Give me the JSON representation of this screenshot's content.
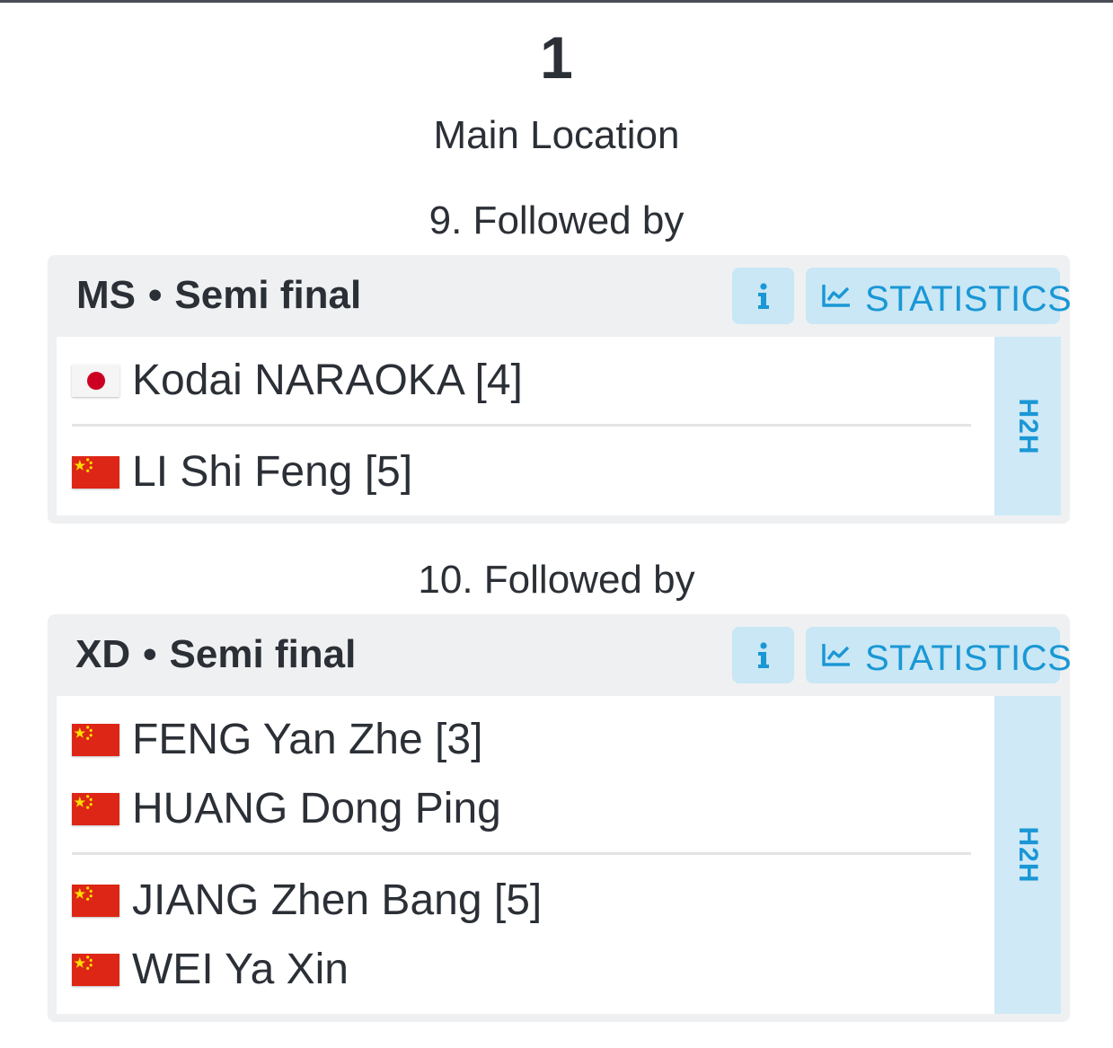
{
  "court": {
    "number": "1",
    "location": "Main Location"
  },
  "matches": [
    {
      "followed_label": "9. Followed by",
      "event": "MS",
      "separator": "•",
      "round": "Semi final",
      "info_icon": "info-icon",
      "statistics_label": "STATISTICS",
      "statistics_icon": "line-chart-icon",
      "h2h_label": "H2H",
      "teams": [
        {
          "players": [
            {
              "name": "Kodai NARAOKA [4]",
              "flag": "japan-flag-icon"
            }
          ]
        },
        {
          "players": [
            {
              "name": "LI Shi Feng [5]",
              "flag": "china-flag-icon"
            }
          ]
        }
      ]
    },
    {
      "followed_label": "10. Followed by",
      "event": "XD",
      "separator": "•",
      "round": "Semi final",
      "info_icon": "info-icon",
      "statistics_label": "STATISTICS",
      "statistics_icon": "line-chart-icon",
      "h2h_label": "H2H",
      "teams": [
        {
          "players": [
            {
              "name": "FENG Yan Zhe [3]",
              "flag": "china-flag-icon"
            },
            {
              "name": "HUANG Dong Ping",
              "flag": "china-flag-icon"
            }
          ]
        },
        {
          "players": [
            {
              "name": "JIANG Zhen Bang [5]",
              "flag": "china-flag-icon"
            },
            {
              "name": "WEI Ya Xin",
              "flag": "china-flag-icon"
            }
          ]
        }
      ]
    }
  ],
  "colors": {
    "accent": "#1a97d5",
    "button_bg": "#c9e7f5",
    "card_bg": "#eff0f2",
    "text": "#2b2f36"
  }
}
